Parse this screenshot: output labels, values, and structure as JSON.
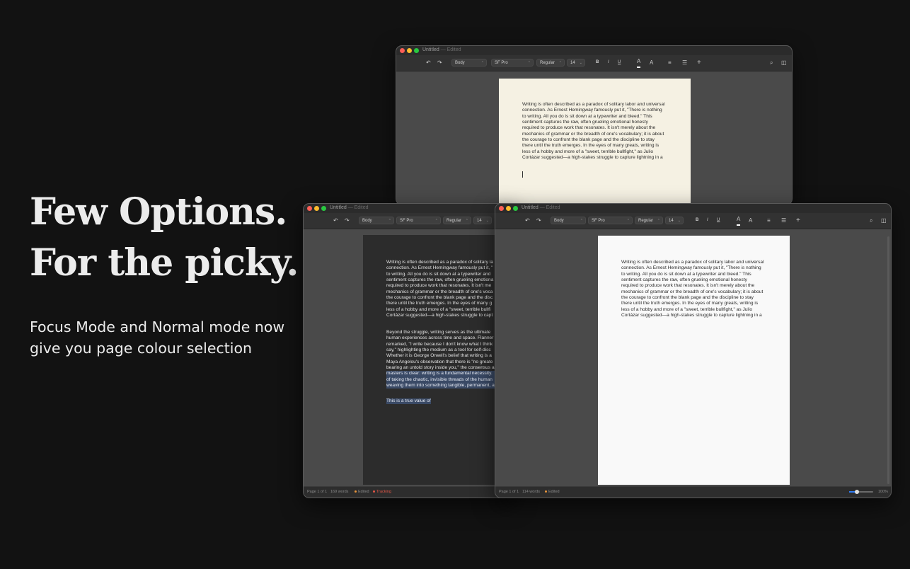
{
  "hero": {
    "line1": "Few Options.",
    "line2": "For the picky.",
    "subtitle": "Focus Mode and Normal mode now give you page colour selection"
  },
  "windows": {
    "title": "Untitled",
    "title_suffix": "— Edited"
  },
  "toolbar": {
    "style": "Body",
    "font": "SF Pro",
    "weight": "Regular",
    "size": "14",
    "bold": "B",
    "italic": "I",
    "underline": "U"
  },
  "documents": {
    "para1_lines": [
      "Writing is often described as a paradox of solitary labor and universal",
      "connection. As Ernest Hemingway famously put it, \"There is nothing",
      "to writing. All you do is sit down at a typewriter and bleed.\" This",
      "sentiment captures the raw, often grueling emotional honesty",
      "required to produce work that resonates. It isn't merely about the",
      "mechanics of grammar or the breadth of one's vocabulary; it is about",
      "the courage to confront the blank page and the discipline to stay",
      "there until the truth emerges. In the eyes of many greats, writing is",
      "less of a hobby and more of a \"sweet, terrible bullfight,\" as Julio",
      "Cortázar suggested—a high-stakes struggle to capture lightning in a"
    ],
    "para1_lines_cut": [
      "Writing is often described as a paradox of solitary la",
      "connection. As Ernest Hemingway famously put it, \"",
      "to writing. All you do is sit down at a typewriter and",
      "sentiment captures the raw, often grueling emotiona",
      "required to produce work that resonates. It isn't me",
      "mechanics of grammar or the breadth of one's voca",
      "the courage to confront the blank page and the disc",
      "there until the truth emerges. In the eyes of many g",
      "less of a hobby and more of a \"sweet, terrible bullfi",
      "Cortázar suggested—a high-stakes struggle to capt"
    ],
    "para2_lines_cut": [
      "Beyond the struggle, writing serves as the ultimate",
      "human experiences across time and space. Flanner",
      "remarked, \"I write because I don't know what I think",
      "say,\" highlighting the medium as a tool for self-disc",
      "Whether it is George Orwell's belief that writing is a",
      "Maya Angelou's observation that there is \"no greate",
      "bearing an untold story inside you,\" the consensus a",
      "masters is clear: writing is a fundamental necessity.",
      "of taking the chaotic, invisible threads of the human",
      "weaving them into something tangible, permanent, a"
    ],
    "para3": "This is a true value of"
  },
  "status": {
    "focus": {
      "page": "Page 1 of 1",
      "words": "169 words",
      "edited": "Edited",
      "tracking": "Tracking"
    },
    "normal": {
      "page": "Page 1 of 1",
      "words": "114 words",
      "edited": "Edited",
      "zoom": "100%"
    }
  },
  "colors": {
    "page_cream": "#f5f1e3",
    "page_white": "#f9f9f9",
    "page_dark": "#2c2c2c",
    "tracking_red": "#e25545",
    "edited_orange": "#e8943a"
  },
  "icons": [
    "undo-icon",
    "redo-icon",
    "text-color-icon",
    "highlight-icon",
    "align-icon",
    "list-icon",
    "plus-icon",
    "search-icon",
    "sidebar-icon"
  ]
}
